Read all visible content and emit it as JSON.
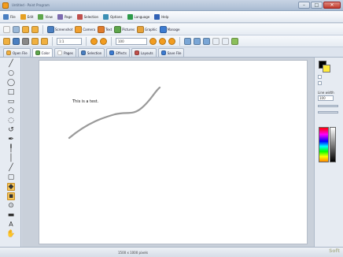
{
  "window": {
    "title": "Untitled - Paint Program",
    "minimize": "–",
    "maximize": "□",
    "close": "✕"
  },
  "menu": [
    {
      "label": "File",
      "icon_color": "#4a7fc1"
    },
    {
      "label": "Edit",
      "icon_color": "#e5a023"
    },
    {
      "label": "View",
      "icon_color": "#5ea64b"
    },
    {
      "label": "Page",
      "icon_color": "#7d6bb0"
    },
    {
      "label": "Selection",
      "icon_color": "#c0504d"
    },
    {
      "label": "Options",
      "icon_color": "#3b8fb5"
    },
    {
      "label": "Language",
      "icon_color": "#2c9a4a"
    },
    {
      "label": "Help",
      "icon_color": "#3161b5"
    }
  ],
  "toolbar1": [
    {
      "name": "Screenshot",
      "color": "#4a7fc1"
    },
    {
      "name": "Camera",
      "color": "#f0a030"
    },
    {
      "name": "Text",
      "color": "#e07b2a"
    },
    {
      "name": "Pictures",
      "color": "#5ea64b"
    },
    {
      "name": "Graphic",
      "color": "#e6a23a"
    },
    {
      "name": "Manage",
      "color": "#3c7bd1"
    }
  ],
  "toolbar2": {
    "zoom": "1:1",
    "size": "100"
  },
  "tabs": [
    {
      "label": "Open File"
    },
    {
      "label": "Color"
    },
    {
      "label": "Pages"
    },
    {
      "label": "Selection"
    },
    {
      "label": "Effects"
    },
    {
      "label": "Layouts"
    },
    {
      "label": "Save File"
    }
  ],
  "canvas": {
    "text": "This is a test."
  },
  "right_panel": {
    "size_label": "Line width",
    "size_value": "100"
  },
  "status": {
    "text": "1500 x 1000 pixels"
  },
  "watermark": "Soft"
}
